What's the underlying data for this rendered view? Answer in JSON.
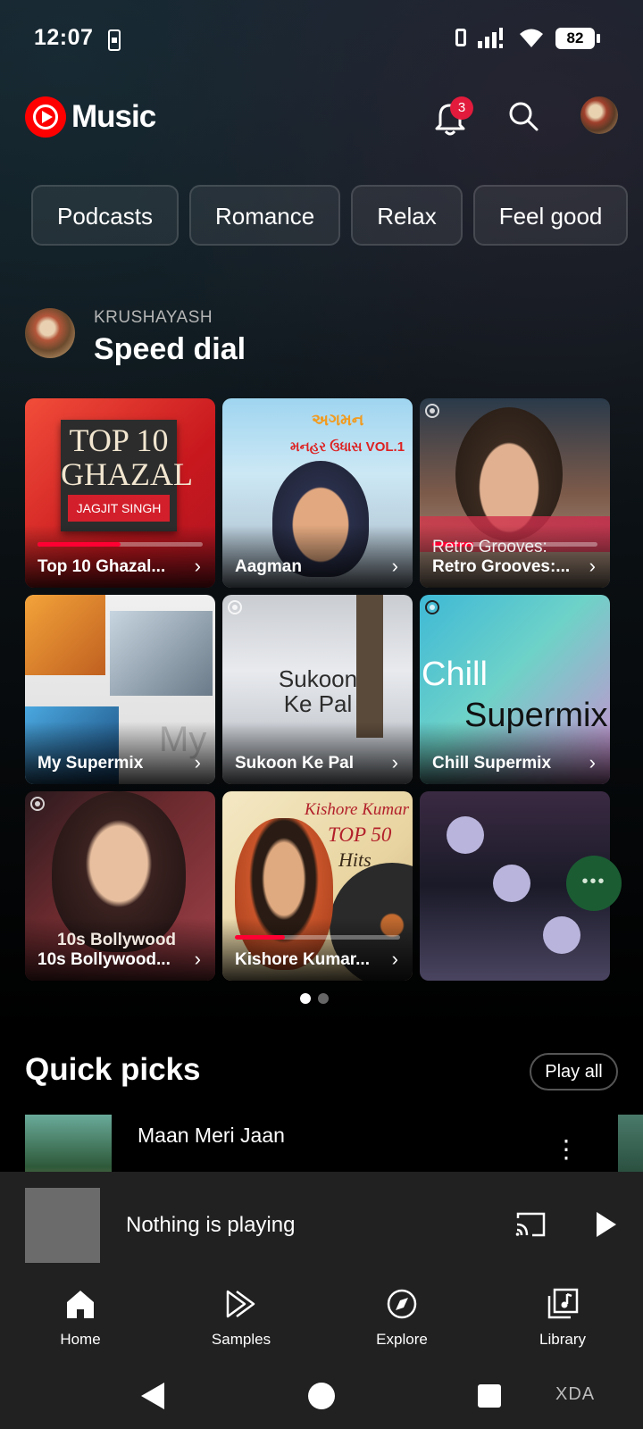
{
  "status_bar": {
    "time": "12:07",
    "battery": "82"
  },
  "header": {
    "app_name": "Music",
    "notification_count": "3"
  },
  "chips": [
    "Podcasts",
    "Romance",
    "Relax",
    "Feel good"
  ],
  "speed_dial": {
    "owner": "KRUSHAYASH",
    "title": "Speed dial",
    "cards": [
      {
        "label": "Top 10 Ghazal...",
        "art_text": "TOP 10 GHAZAL",
        "art_sub": "JAGJIT SINGH",
        "progress": 0.5
      },
      {
        "label": "Aagman",
        "art_text": "અગમન",
        "art_sub": "મનહર ઉધાસ VOL.1"
      },
      {
        "label": "Retro Grooves:...",
        "art_text": "Retro Grooves:",
        "progress": 0.25
      },
      {
        "label": "My Supermix",
        "art_text": "My"
      },
      {
        "label": "Sukoon Ke Pal",
        "art_text": "Sukoon Ke Pal"
      },
      {
        "label": "Chill Supermix",
        "art_text": "Chill",
        "art_sub": "Supermix"
      },
      {
        "label": "10s Bollywood...",
        "art_text": "10s Bollywood"
      },
      {
        "label": "Kishore Kumar...",
        "art_text": "Kishore Kumar",
        "art_sub": "TOP 50",
        "art_sub2": "Hits",
        "progress": 0.3
      },
      {
        "label": ""
      }
    ],
    "page_count": 2,
    "active_page": 0
  },
  "quick_picks": {
    "title": "Quick picks",
    "play_all": "Play all",
    "first_song": "Maan Meri Jaan"
  },
  "mini_player": {
    "status": "Nothing is playing"
  },
  "bottom_nav": [
    {
      "label": "Home",
      "icon": "home-icon"
    },
    {
      "label": "Samples",
      "icon": "samples-icon"
    },
    {
      "label": "Explore",
      "icon": "explore-icon"
    },
    {
      "label": "Library",
      "icon": "library-icon"
    }
  ],
  "watermark": "XDA",
  "colors": {
    "brand_red": "#ff0000",
    "badge_red": "#e21b3c",
    "fab_green": "#1b5c33"
  }
}
